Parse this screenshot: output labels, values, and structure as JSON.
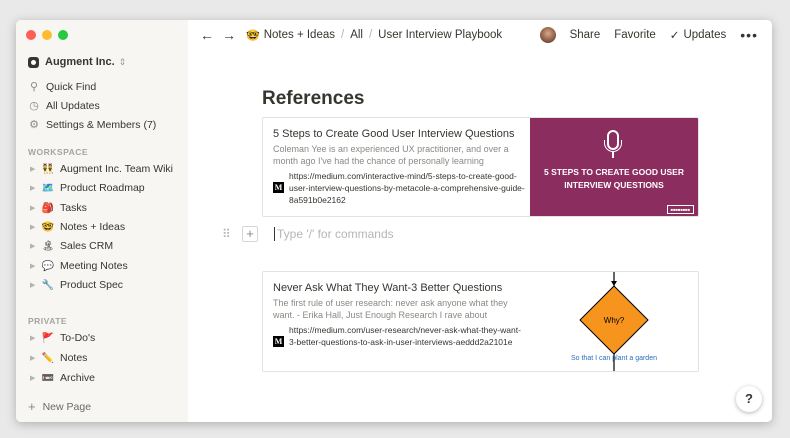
{
  "sidebar": {
    "workspace": "Augment Inc.",
    "nav": [
      {
        "label": "Quick Find",
        "icon": "search-icon"
      },
      {
        "label": "All Updates",
        "icon": "clock-icon"
      },
      {
        "label": "Settings & Members (7)",
        "icon": "gear-icon"
      }
    ],
    "workspace_section": "WORKSPACE",
    "workspace_pages": [
      {
        "emoji": "👯",
        "label": "Augment Inc. Team Wiki"
      },
      {
        "emoji": "🗺️",
        "label": "Product Roadmap"
      },
      {
        "emoji": "🎒",
        "label": "Tasks"
      },
      {
        "emoji": "🤓",
        "label": "Notes + Ideas"
      },
      {
        "emoji": "🏝",
        "label": "Sales CRM"
      },
      {
        "emoji": "💬",
        "label": "Meeting Notes"
      },
      {
        "emoji": "🔧",
        "label": "Product Spec"
      }
    ],
    "private_section": "PRIVATE",
    "private_pages": [
      {
        "emoji": "🚩",
        "label": "To-Do's"
      },
      {
        "emoji": "✏️",
        "label": "Notes"
      },
      {
        "emoji": "📼",
        "label": "Archive"
      }
    ],
    "new_page": "New Page"
  },
  "topbar": {
    "breadcrumb_emoji": "🤓",
    "breadcrumb": [
      "Notes + Ideas",
      "All",
      "User Interview Playbook"
    ],
    "share": "Share",
    "favorite": "Favorite",
    "updates": "Updates",
    "more": "•••"
  },
  "content": {
    "heading": "References",
    "command_placeholder": "Type '/' for commands",
    "bookmarks": [
      {
        "title": "5 Steps to Create Good User Interview Questions",
        "description": "Coleman Yee is an experienced UX practitioner, and over a month ago I've had the chance of personally learning",
        "url": "https://medium.com/interactive-mind/5-steps-to-create-good-user-interview-questions-by-metacole-a-comprehensive-guide-8a591b0e2162",
        "image_text": "5 STEPS TO CREATE GOOD USER INTERVIEW QUESTIONS",
        "image_color": "#8b2d5e"
      },
      {
        "title": "Never Ask What They Want-3 Better Questions",
        "description": "The first rule of user research: never ask anyone what they want. - Erika Hall, Just Enough Research I rave about",
        "url": "https://medium.com/user-research/never-ask-what-they-want-3-better-questions-to-ask-in-user-interviews-aeddd2a2101e",
        "diagram_label": "Why?",
        "diagram_caption": "So that I can plant a garden"
      }
    ]
  },
  "help": "?"
}
